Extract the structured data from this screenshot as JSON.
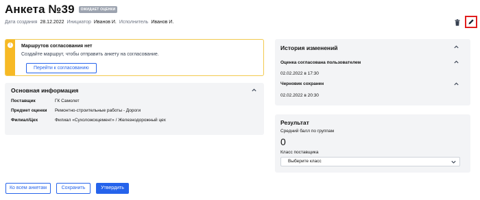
{
  "header": {
    "title": "Анкета №39",
    "status": "ОЖИДАЕТ ОЦЕНКИ"
  },
  "meta": {
    "created_label": "Дата создания",
    "created_value": "28.12.2022",
    "initiator_label": "Инициатор",
    "initiator_value": "Иванов И.",
    "executor_label": "Исполнитель",
    "executor_value": "Иванов И."
  },
  "notice": {
    "icon": "!",
    "title": "Маршрутов согласования нет",
    "text": "Создайте маршрут, чтобы отправить анкету на согласование.",
    "button": "Перейти к согласованию"
  },
  "info": {
    "title": "Основная информация",
    "rows": [
      {
        "key": "Поставщик",
        "value": "ГК Самолет"
      },
      {
        "key": "Предмет оценки",
        "value": "Ремонтно-строительные работы - Дороги"
      },
      {
        "key": "Филиал/Цех",
        "value": "Филиал «Сухоложскцемент» / Железнодорожный цех"
      }
    ]
  },
  "history": {
    "title": "История изменений",
    "items": [
      {
        "title": "Оценка согласована пользователем",
        "date": "02.02.2022 в 17:30"
      },
      {
        "title": "Черновик сохранен",
        "date": "02.02.2022 в 20:30"
      }
    ]
  },
  "result": {
    "title": "Результат",
    "avg_label": "Средний балл по группам",
    "avg_value": "0",
    "class_label": "Класс поставщика",
    "class_placeholder": "Выберите класс"
  },
  "footer": {
    "all_button": "Ко всем анкетам",
    "save_button": "Сохранить",
    "approve_button": "Утвердить"
  },
  "icons": {
    "trash": "trash-icon",
    "edit": "pencil-icon",
    "chevron_up": "chevron-up-icon",
    "chevron_down": "chevron-down-icon"
  },
  "colors": {
    "accent": "#2563eb",
    "warning": "#f7b924",
    "highlight": "#e11d1d",
    "badge": "#9ca3af"
  }
}
